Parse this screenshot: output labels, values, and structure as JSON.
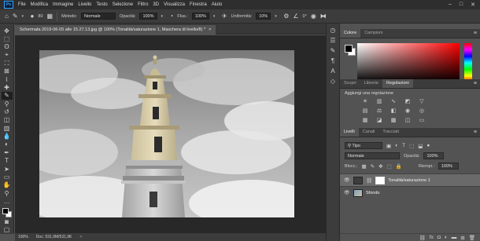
{
  "app": {
    "logo": "Ps"
  },
  "menu": [
    "File",
    "Modifica",
    "Immagine",
    "Livello",
    "Testo",
    "Selezione",
    "Filtro",
    "3D",
    "Visualizza",
    "Finestra",
    "Aiuto"
  ],
  "window_controls": [
    "–",
    "□",
    "✕"
  ],
  "options": {
    "brush_size": "80",
    "mode_label": "Metodo:",
    "mode_value": "Normale",
    "opacity_label": "Opacità:",
    "opacity_value": "100%",
    "flow_label": "Flus.:",
    "flow_value": "100%",
    "smoothing_label": "Uniformità:",
    "smoothing_value": "10%",
    "angle_value": "0°"
  },
  "document": {
    "tab_title": "Schermata 2019-06-05 alle 15.27.13.jpg @ 100% (Tonalità/saturazione 1, Maschera di livello/8) *",
    "close": "×"
  },
  "status": {
    "zoom": "100%",
    "doc_info": "Doc: 531,9M/531,9K",
    "arrow": ">"
  },
  "color_panel": {
    "tabs": [
      "Colore",
      "Campioni"
    ],
    "active_tab": 0,
    "foreground": "#000000",
    "background": "#ffffff"
  },
  "adjustments_panel": {
    "tabs": [
      "Scopri",
      "Librerie",
      "Regolazioni"
    ],
    "active_tab": 2,
    "title": "Aggiungi una regolazione"
  },
  "layers_panel": {
    "tabs": [
      "Livelli",
      "Canali",
      "Tracciati"
    ],
    "active_tab": 0,
    "filter_label": "Tipo",
    "blend_mode": "Normale",
    "opacity_label": "Opacità:",
    "opacity_value": "100%",
    "lock_label": "Blocc.:",
    "fill_label": "Riempi.:",
    "fill_value": "100%",
    "layers": [
      {
        "name": "Tonalità/saturazione 1",
        "selected": true
      },
      {
        "name": "Sfondo",
        "selected": false
      }
    ]
  }
}
